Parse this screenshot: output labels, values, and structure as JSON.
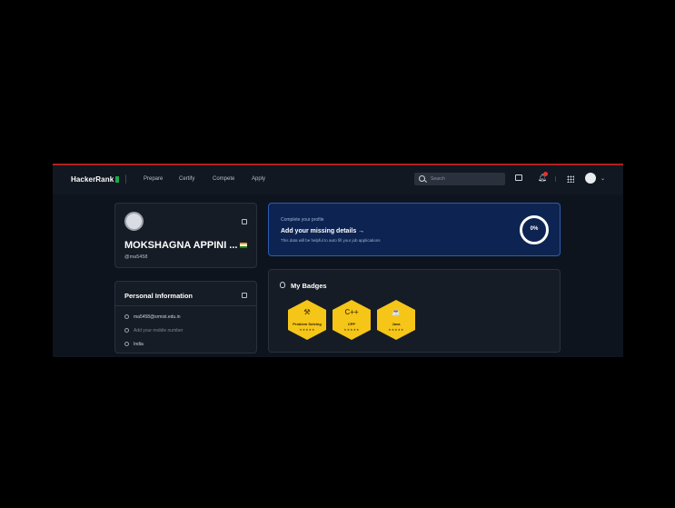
{
  "header": {
    "brand": "HackerRank",
    "nav": [
      "Prepare",
      "Certify",
      "Compete",
      "Apply"
    ],
    "search_placeholder": "Search",
    "notification_count": "1"
  },
  "profile": {
    "name": "MOKSHAGNA APPINI ...",
    "username": "@ma5458"
  },
  "personal_info": {
    "title": "Personal Information",
    "email": "ma5458@srmist.edu.in",
    "mobile_placeholder": "Add your mobile number",
    "country": "India"
  },
  "complete_profile": {
    "eyebrow": "Complete your profile",
    "title": "Add your missing details →",
    "subtitle": "This data will be helpful to auto fill your job applications",
    "percent": "0%"
  },
  "badges": {
    "title": "My Badges",
    "items": [
      {
        "name": "Problem Solving",
        "icon": "⚒",
        "stars": "★★★★★"
      },
      {
        "name": "CPP",
        "icon": "C++",
        "stars": "★★★★★"
      },
      {
        "name": "Java",
        "icon": "☕",
        "stars": "★★★★★"
      }
    ]
  },
  "colors": {
    "background": "#0e141e",
    "brand_green": "#1ba94c",
    "badge_gold": "#f5c518",
    "complete_card": "#0d2452"
  }
}
